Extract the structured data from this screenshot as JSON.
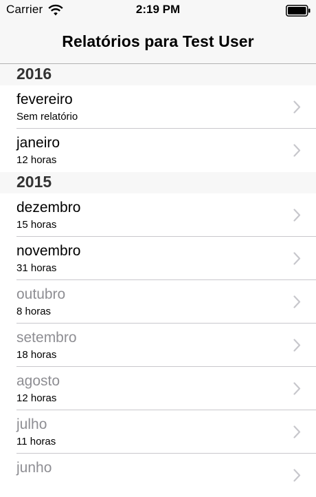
{
  "status_bar": {
    "carrier": "Carrier",
    "time": "2:19 PM"
  },
  "nav": {
    "title": "Relatórios para Test User"
  },
  "sections": [
    {
      "year": "2016",
      "rows": [
        {
          "month": "fevereiro",
          "detail": "Sem relatório",
          "dimmed": false
        },
        {
          "month": "janeiro",
          "detail": "12 horas",
          "dimmed": false
        }
      ]
    },
    {
      "year": "2015",
      "rows": [
        {
          "month": "dezembro",
          "detail": "15 horas",
          "dimmed": false
        },
        {
          "month": "novembro",
          "detail": "31 horas",
          "dimmed": false
        },
        {
          "month": "outubro",
          "detail": "8 horas",
          "dimmed": true
        },
        {
          "month": "setembro",
          "detail": "18 horas",
          "dimmed": true
        },
        {
          "month": "agosto",
          "detail": "12 horas",
          "dimmed": true
        },
        {
          "month": "julho",
          "detail": "11 horas",
          "dimmed": true
        },
        {
          "month": "junho",
          "detail": "",
          "dimmed": true
        }
      ]
    }
  ],
  "colors": {
    "bar_background": "#f7f7f7",
    "separator": "#c8c7cc",
    "dimmed_text": "#8e8e93",
    "chevron": "#c7c7cc"
  },
  "icons": {
    "wifi": "wifi-icon",
    "battery": "battery-icon",
    "chevron": "chevron-right-icon"
  }
}
